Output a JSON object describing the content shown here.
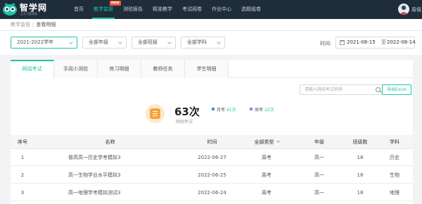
{
  "brand": {
    "name": "智学网",
    "slogan": "让学习更高效"
  },
  "nav": [
    {
      "label": "首页",
      "active": false
    },
    {
      "label": "教学监管",
      "active": true,
      "badge": "new"
    },
    {
      "label": "测验报告",
      "active": false
    },
    {
      "label": "精准教学",
      "active": false
    },
    {
      "label": "考试阅卷",
      "active": false
    },
    {
      "label": "作业中心",
      "active": false
    },
    {
      "label": "选题组卷",
      "active": false
    }
  ],
  "user": {
    "name": "周佩"
  },
  "breadcrumb": {
    "parent": "教学监管",
    "separator": "/",
    "current": "查看明细"
  },
  "filters": {
    "year": "2021-2022学年",
    "grade": "全部年级",
    "class": "全部班级",
    "subject": "全部学科",
    "time_label": "时间:",
    "date_start": "2021-08-15",
    "date_sep": "至",
    "date_end": "2022-08-14"
  },
  "tabs": [
    {
      "label": "网阅考试",
      "active": true
    },
    {
      "label": "手阅小测验",
      "active": false
    },
    {
      "label": "练习明细",
      "active": false
    },
    {
      "label": "教师任务",
      "active": false
    },
    {
      "label": "学生明细",
      "active": false
    }
  ],
  "search": {
    "placeholder": "请输入网阅考试名称"
  },
  "export_label": "导出Excel",
  "stats": {
    "count": "63次",
    "label": "网阅考试",
    "legend": [
      {
        "label": "月考",
        "value": "41次",
        "color": "#4a8fe7"
      },
      {
        "label": "周考",
        "value": "22次",
        "color": "#7b8fe0"
      }
    ]
  },
  "table": {
    "headers": [
      "序号",
      "名称",
      "时间",
      "全部类型",
      "年级",
      "班级数",
      "学科"
    ],
    "rows": [
      [
        "1",
        "普高高一历史学考模拟3",
        "2022-06-27",
        "周考",
        "高一",
        "18",
        "历史"
      ],
      [
        "2",
        "高一生物学业水平模拟3",
        "2022-06-25",
        "周考",
        "高一",
        "18",
        "生物"
      ],
      [
        "3",
        "高一地理学考模拟测试3",
        "2022-06-24",
        "周考",
        "高一",
        "18",
        "地理"
      ]
    ]
  },
  "colors": {
    "accent": "#1fc4a8",
    "nav_bg": "#1f2d3a",
    "badge": "#f25c3b",
    "stats_icon": "#f6a43c"
  }
}
